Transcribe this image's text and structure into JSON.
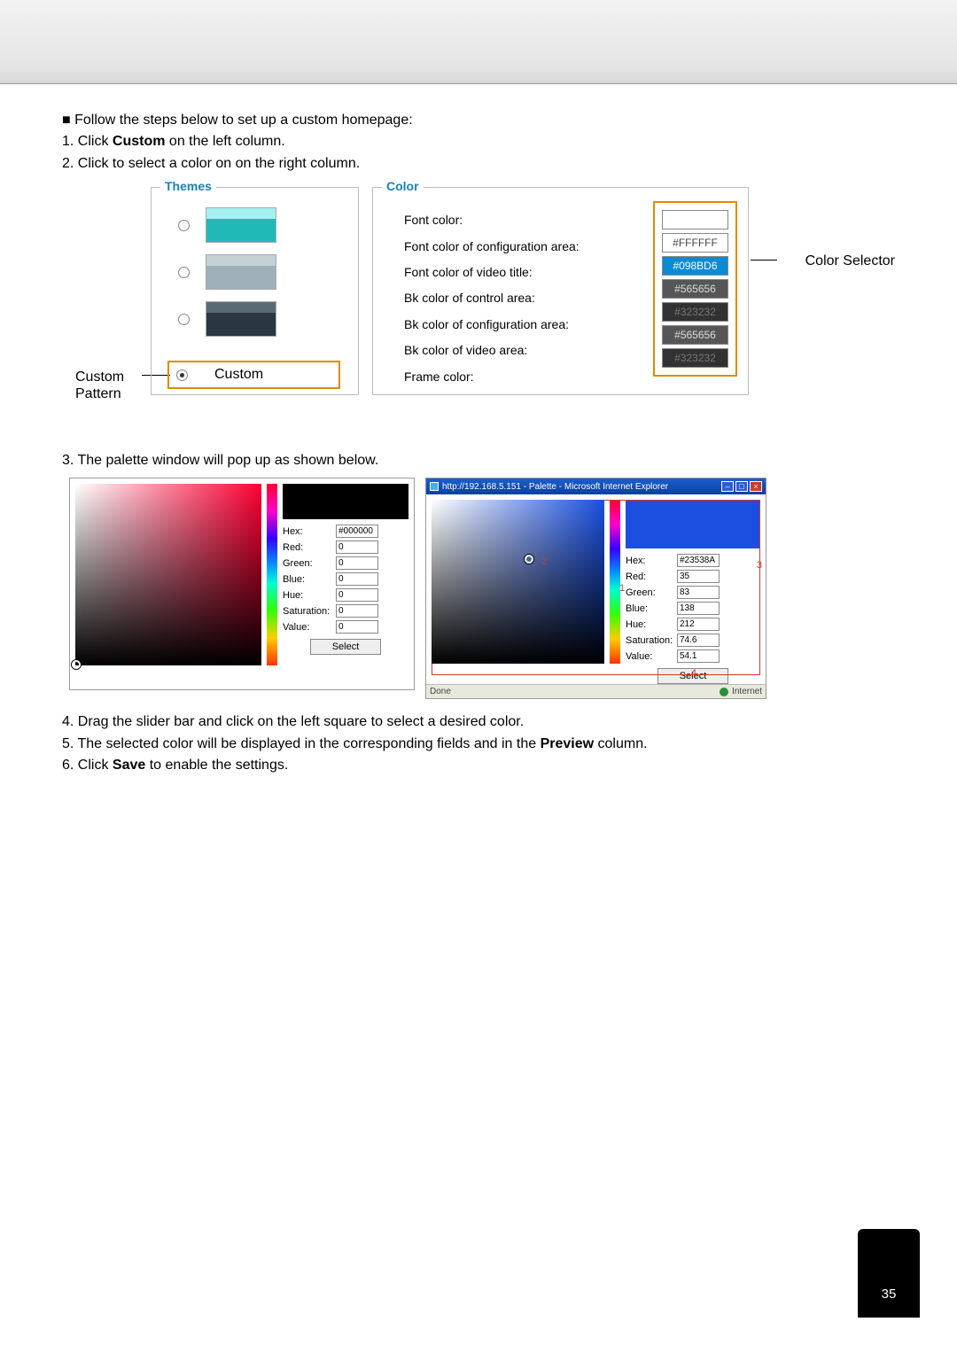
{
  "intro": {
    "bullet": "■ Follow the steps below to set up a custom homepage:",
    "step1_a": "1. Click ",
    "step1_bold": "Custom",
    "step1_b": " on the left column.",
    "step2": "2. Click to select a color on on the right column."
  },
  "labels": {
    "custom_pattern_1": "Custom",
    "custom_pattern_2": "Pattern",
    "color_selector": "Color Selector"
  },
  "themes": {
    "legend": "Themes",
    "custom": "Custom"
  },
  "color": {
    "legend": "Color",
    "rows": {
      "font_color": "Font color:",
      "font_config": "Font color of configuration area:",
      "font_video": "Font color of video title:",
      "bk_control": "Bk color of control area:",
      "bk_config": "Bk color of configuration area:",
      "bk_video": "Bk color of video area:",
      "frame": "Frame color:"
    },
    "vals": {
      "font_color": "",
      "font_config": "#FFFFFF",
      "font_video": "#098BD6",
      "bk_control": "#565656",
      "bk_config": "#323232",
      "bk_video": "#565656",
      "frame": "#323232"
    }
  },
  "step3": "3. The palette window will pop up as shown below.",
  "palette1": {
    "hex_label": "Hex:",
    "red_label": "Red:",
    "green_label": "Green:",
    "blue_label": "Blue:",
    "hue_label": "Hue:",
    "sat_label": "Saturation:",
    "val_label": "Value:",
    "hex": "#000000",
    "red": "0",
    "green": "0",
    "blue": "0",
    "hue": "0",
    "sat": "0",
    "val": "0",
    "select": "Select"
  },
  "palette2": {
    "title": "http://192.168.5.151 - Palette - Microsoft Internet Explorer",
    "hex_label": "Hex:",
    "red_label": "Red:",
    "green_label": "Green:",
    "blue_label": "Blue:",
    "hue_label": "Hue:",
    "sat_label": "Saturation:",
    "val_label": "Value:",
    "hex": "#23538A",
    "red": "35",
    "green": "83",
    "blue": "138",
    "hue": "212",
    "sat": "74.6",
    "val": "54.1",
    "select": "Select",
    "n1": "1",
    "n2": "2",
    "n3": "3",
    "n4": "4",
    "done": "Done",
    "internet": "Internet"
  },
  "final": {
    "s4": "4. Drag the slider bar and click on the left square to select a desired color.",
    "s5_a": "5. The selected color will be displayed in the corresponding fields and in the ",
    "s5_bold": "Preview",
    "s5_b": " column.",
    "s6_a": "6. Click ",
    "s6_bold": "Save",
    "s6_b": " to enable the settings."
  },
  "page_number": "35"
}
